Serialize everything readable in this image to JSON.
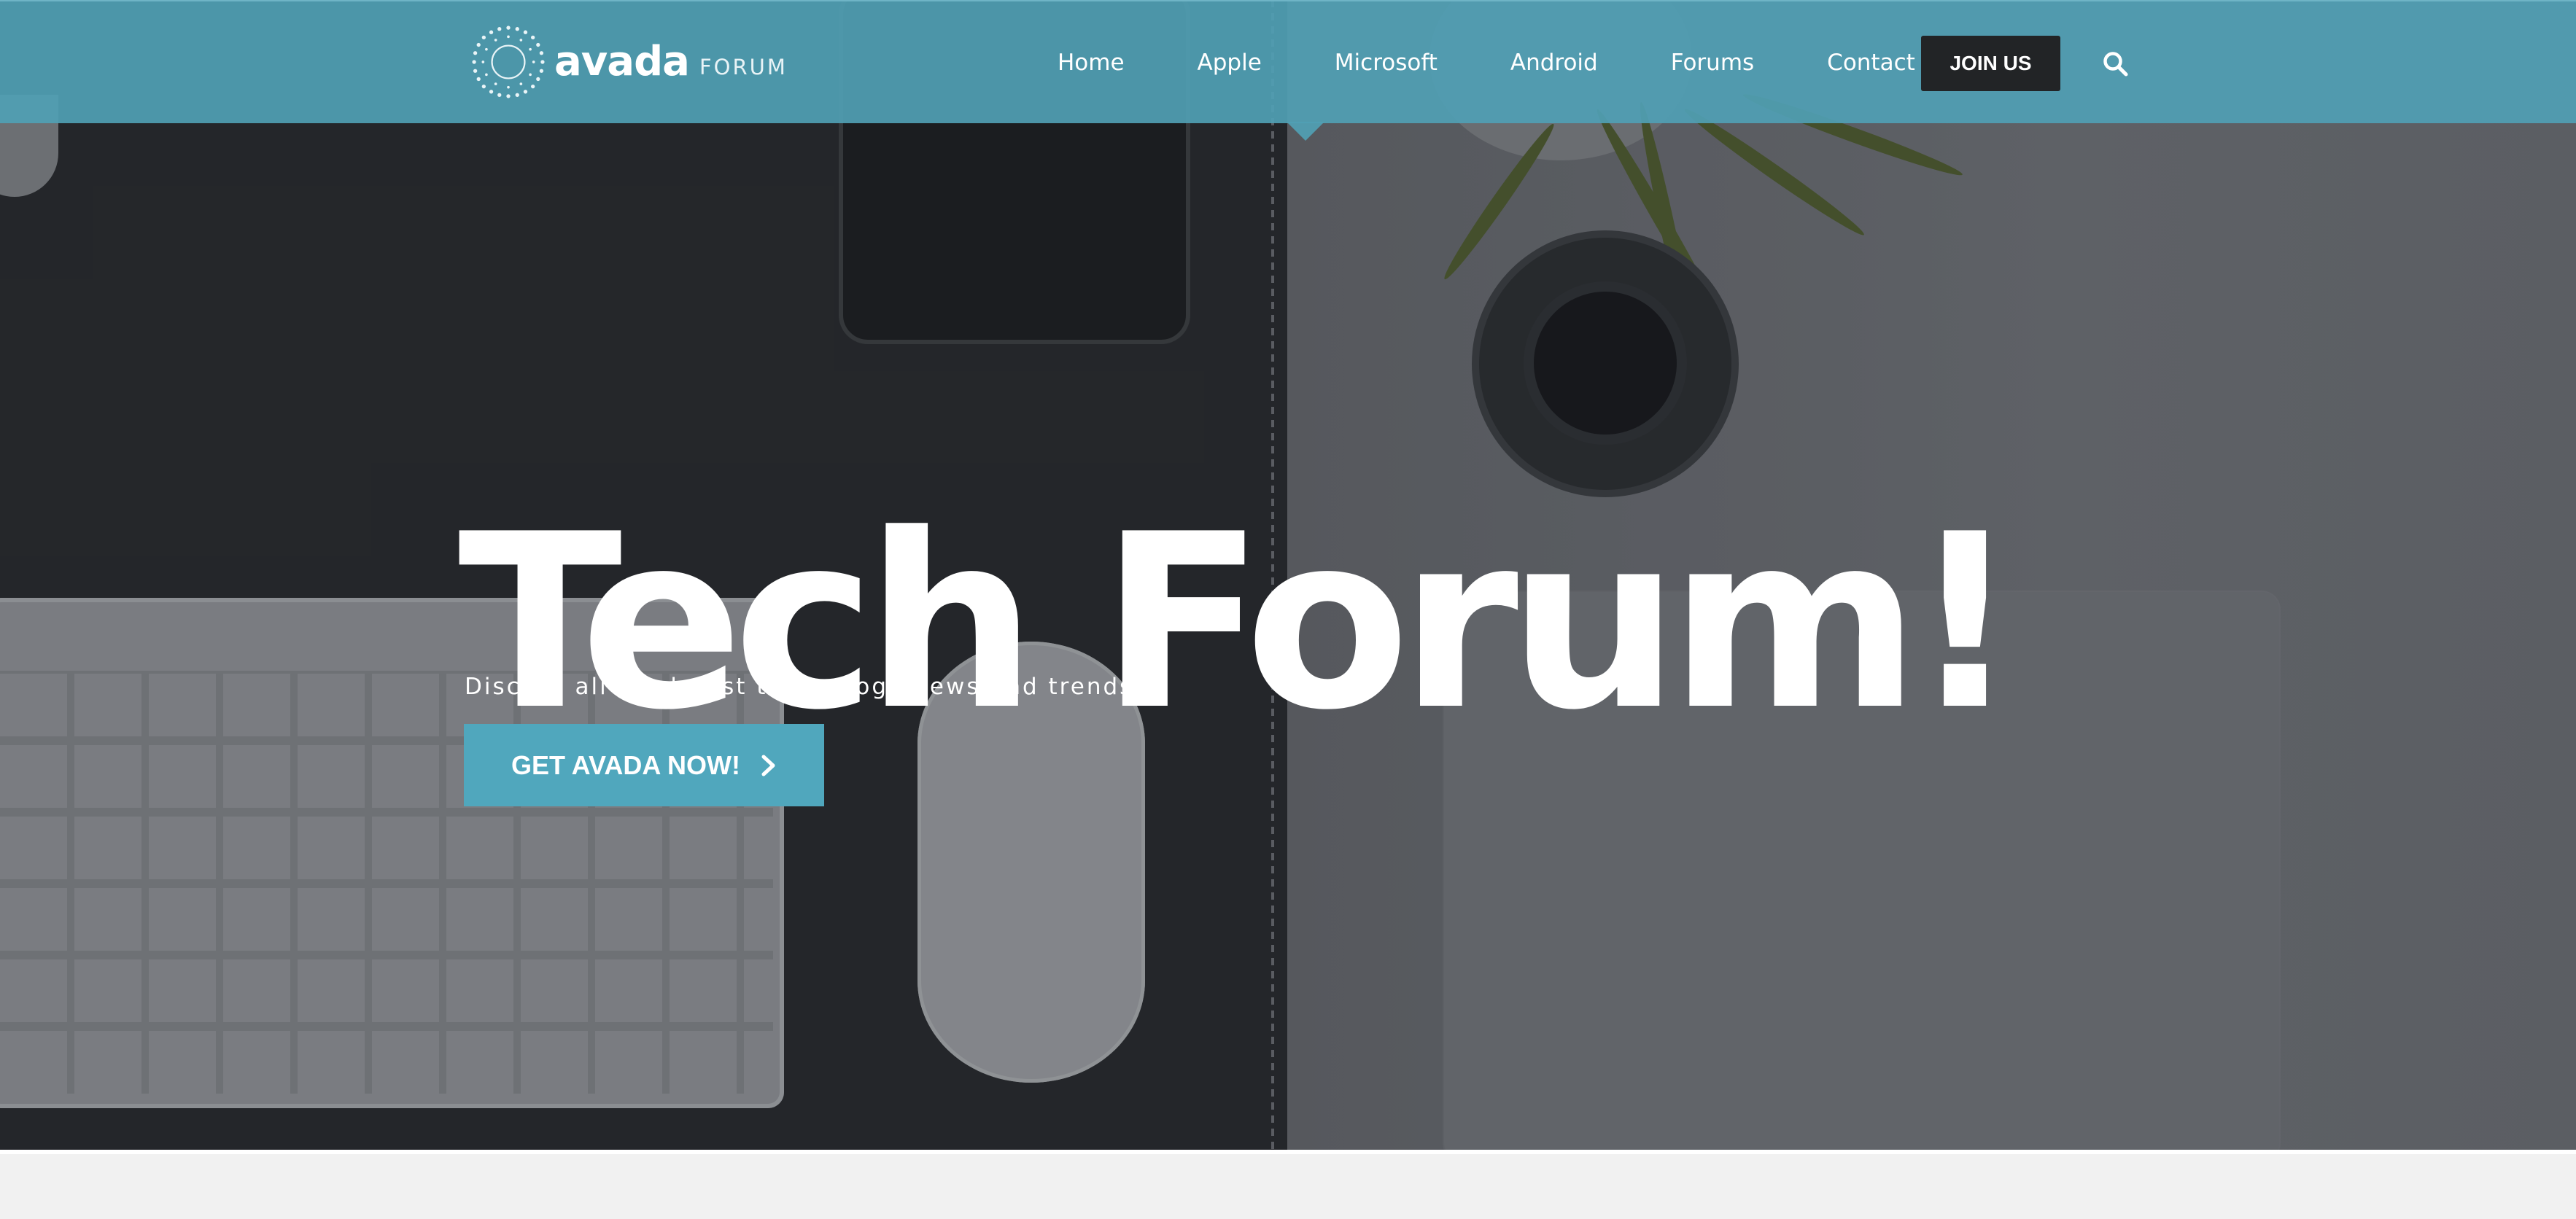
{
  "brand": {
    "logo_word": "avada",
    "logo_sub": "FORUM",
    "accent_color": "#50a7bd",
    "header_color": "#50a0b4",
    "dark_button_color": "#222426"
  },
  "nav": {
    "items": [
      {
        "label": "Home"
      },
      {
        "label": "Apple"
      },
      {
        "label": "Microsoft"
      },
      {
        "label": "Android"
      },
      {
        "label": "Forums"
      },
      {
        "label": "Contact us"
      }
    ],
    "join_label": "JOIN US",
    "search_icon": "search-icon"
  },
  "hero": {
    "title": "Tech Forum!",
    "subtitle": "Discuss all the latest technology news and trends",
    "cta_label": "GET AVADA NOW!",
    "cta_icon": "chevron-right-icon"
  }
}
